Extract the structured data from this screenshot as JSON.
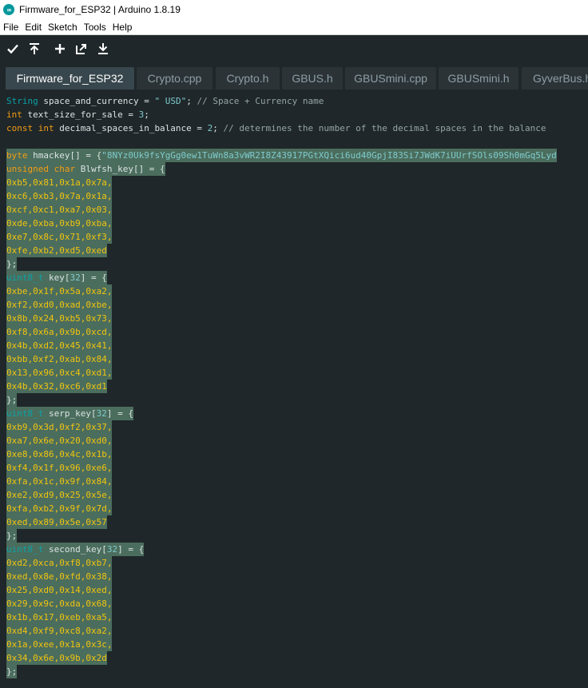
{
  "window": {
    "title": "Firmware_for_ESP32 | Arduino 1.8.19",
    "logo_glyph": "∞"
  },
  "menu": [
    "File",
    "Edit",
    "Sketch",
    "Tools",
    "Help"
  ],
  "toolbar": {
    "buttons": [
      {
        "name": "verify-button",
        "icon": "check-icon"
      },
      {
        "name": "upload-button",
        "icon": "upload-arrow-icon"
      },
      {
        "name": "new-button",
        "icon": "plus-icon"
      },
      {
        "name": "open-button",
        "icon": "open-arrow-icon"
      },
      {
        "name": "save-button",
        "icon": "download-arrow-icon"
      }
    ]
  },
  "tabs": [
    "Firmware_for_ESP32",
    "Crypto.cpp",
    "Crypto.h",
    "GBUS.h",
    "GBUSmini.cpp",
    "GBUSmini.h",
    "GyverBus.h"
  ],
  "active_tab": 0,
  "colors": {
    "background": "#1f272a",
    "active_tab": "#38474d",
    "tab": "#2b3337",
    "selection": "#4b6d5d",
    "keyword": "#f39c12",
    "type": "#0ca1a6",
    "number": "#7fcbcd",
    "comment": "#95a5a6",
    "hex": "#f1c40f"
  },
  "code": {
    "line1": [
      "String",
      " space_and_currency = ",
      "\" USD\"",
      "; ",
      "// Space + Currency name"
    ],
    "line2": [
      "int",
      " text_size_for_sale = ",
      "3",
      ";"
    ],
    "line3": [
      "const int",
      " decimal_spaces_in_balance = ",
      "2",
      "; ",
      "// determines the number of the decimal spaces in the balance"
    ],
    "hmac_decl": [
      "byte",
      " hmackey[] = {",
      "\"8NYz0Uk9fsYgGg0ew1TuWn8a3vWR2I8Z43917PGtXQici6ud40GpjI83Si7JWdK7iUUrfSOls09Sh0mGq5Lyd"
    ],
    "blw_decl": [
      "unsigned char",
      " Blwfsh_key[] = {"
    ],
    "blw_vals": [
      "0xb5,0x81,0x1a,0x7a,",
      "0xc6,0xb3,0x7a,0x1a,",
      "0xcf,0xc1,0xa7,0x03,",
      "0xde,0xba,0xb9,0xba,",
      "0xe7,0x8c,0x71,0xf3,",
      "0xfe,0xb2,0xd5,0xed"
    ],
    "close": "};",
    "key_decl": [
      "uint8_t",
      " key[",
      "32",
      "] = {"
    ],
    "key_vals": [
      "0xbe,0x1f,0x5a,0xa2,",
      "0xf2,0xd0,0xad,0xbe,",
      "0x8b,0x24,0xb5,0x73,",
      "0xf8,0x6a,0x9b,0xcd,",
      "0x4b,0xd2,0x45,0x41,",
      "0xbb,0xf2,0xab,0x84,",
      "0x13,0x96,0xc4,0xd1,",
      "0x4b,0x32,0xc6,0xd1"
    ],
    "serp_decl": [
      "uint8_t",
      " serp_key[",
      "32",
      "] = {"
    ],
    "serp_vals": [
      "0xb9,0x3d,0xf2,0x37,",
      "0xa7,0x6e,0x20,0xd0,",
      "0xe8,0x86,0x4c,0x1b,",
      "0xf4,0x1f,0x96,0xe6,",
      "0xfa,0x1c,0x9f,0x84,",
      "0xe2,0xd9,0x25,0x5e,",
      "0xfa,0xb2,0x9f,0x7d,",
      "0xed,0x89,0x5e,0x57"
    ],
    "second_decl": [
      "uint8_t",
      " second_key[",
      "32",
      "] = {"
    ],
    "second_vals": [
      "0xd2,0xca,0xf8,0xb7,",
      "0xed,0x8e,0xfd,0x38,",
      "0x25,0xd0,0x14,0xed,",
      "0x29,0x9c,0xda,0x68,",
      "0x1b,0x17,0xeb,0xa5,",
      "0xd4,0xf9,0xc8,0xa2,",
      "0x1a,0xee,0x1a,0x3c,",
      "0x34,0x6e,0x9b,0x2d"
    ]
  }
}
